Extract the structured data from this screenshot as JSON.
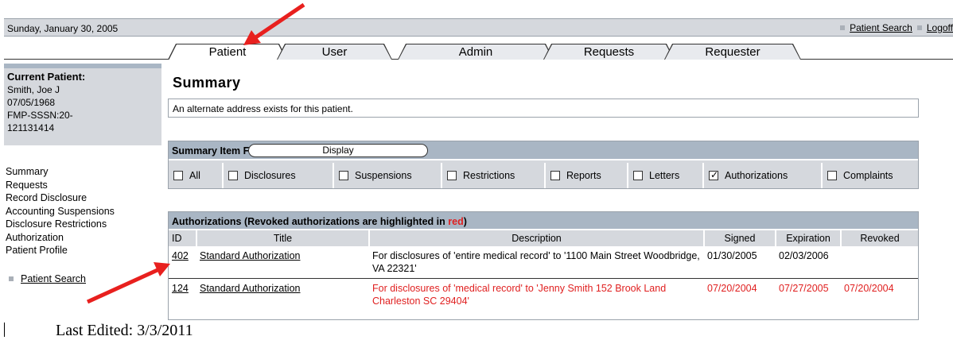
{
  "topbar": {
    "date": "Sunday, January 30, 2005",
    "links": [
      {
        "label": "Patient Search"
      },
      {
        "label": "Logoff"
      }
    ]
  },
  "tabs": [
    "Patient",
    "User",
    "Admin",
    "Requests",
    "Requester"
  ],
  "active_tab": "Patient",
  "patient": {
    "heading": "Current Patient:",
    "name": "Smith, Joe J",
    "dob": "07/05/1968",
    "ssn_line1": "FMP-SSSN:20-",
    "ssn_line2": "121131414"
  },
  "nav": [
    "Summary",
    "Requests",
    "Record Disclosure",
    "Accounting Suspensions",
    "Disclosure Restrictions",
    "Authorization",
    "Patient Profile"
  ],
  "left_search": "Patient Search",
  "page_title": "Summary",
  "alert": "An alternate address exists for this patient.",
  "filters": {
    "label": "Summary Item Filters",
    "button": "Display",
    "items": [
      {
        "label": "All",
        "checked": false
      },
      {
        "label": "Disclosures",
        "checked": false
      },
      {
        "label": "Suspensions",
        "checked": false
      },
      {
        "label": "Restrictions",
        "checked": false
      },
      {
        "label": "Reports",
        "checked": false
      },
      {
        "label": "Letters",
        "checked": false
      },
      {
        "label": "Authorizations",
        "checked": true
      },
      {
        "label": "Complaints",
        "checked": false
      }
    ]
  },
  "auth": {
    "title_prefix": "Authorizations (Revoked authorizations are highlighted in ",
    "title_red": "red",
    "title_suffix": ")",
    "columns": [
      "ID",
      "Title",
      "Description",
      "Signed",
      "Expiration",
      "Revoked"
    ],
    "rows": [
      {
        "id": "402",
        "title": "Standard Authorization",
        "description": "For disclosures of 'entire medical record' to '1100 Main Street Woodbridge, VA 22321'",
        "signed": "01/30/2005",
        "expiration": "02/03/2006",
        "revoked": ""
      },
      {
        "id": "124",
        "title": "Standard Authorization",
        "description": "For disclosures of 'medical record' to 'Jenny Smith 152 Brook Land Charleston SC 29404'",
        "signed": "07/20/2004",
        "expiration": "07/27/2005",
        "revoked": "07/20/2004"
      }
    ]
  },
  "colors": {
    "revoked": "#e02020",
    "header_blue": "#a9b6c4",
    "panel_gray": "#d5d8dd",
    "arrow": "#e8201e"
  },
  "footer": "Last Edited: 3/3/2011"
}
